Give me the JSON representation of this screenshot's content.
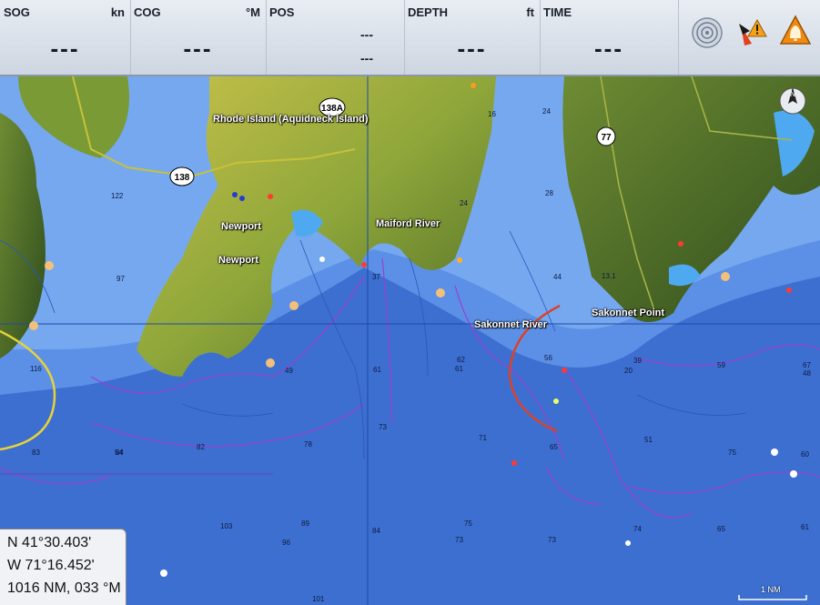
{
  "topbar": {
    "sog": {
      "label": "SOG",
      "unit": "kn",
      "value": "---"
    },
    "cog": {
      "label": "COG",
      "unit": "°M",
      "value": "---"
    },
    "pos": {
      "label": "POS",
      "value_lat": "---",
      "value_lon": "---"
    },
    "depth": {
      "label": "DEPTH",
      "unit": "ft",
      "value": "---"
    },
    "time": {
      "label": "TIME",
      "value": "---"
    },
    "icons": [
      "gps-satellite-icon",
      "alarm-warning-icon",
      "alert-warning-icon"
    ]
  },
  "map": {
    "place_labels": [
      "Rhode Island (Aquidneck Island)",
      "Newport",
      "Newport",
      "Maiford River",
      "Sakonnet River",
      "Sakonnet Point"
    ],
    "route_shields": [
      "138A",
      "138",
      "77"
    ],
    "depth_soundings": [
      "116",
      "122",
      "97",
      "83",
      "84",
      "82",
      "78",
      "73",
      "71",
      "61",
      "37",
      "62",
      "61",
      "56",
      "65",
      "44",
      "59",
      "67",
      "48",
      "39",
      "20",
      "51",
      "75",
      "60",
      "61",
      "74",
      "65",
      "73",
      "89",
      "96",
      "103",
      "101",
      "84",
      "75",
      "73",
      "28",
      "24",
      "16",
      "13.1",
      "24",
      "49",
      "54"
    ],
    "cursor_readout": {
      "lat": "N  41°30.403'",
      "lon": "W  71°16.452'",
      "range_bearing": "1016 NM, 033 °M"
    },
    "scale_label": "1 NM",
    "colors": {
      "deep_water": "#3d6fd0",
      "shallow_water": "#6ea3ee",
      "land": "#8aa23a",
      "contour": "#9a3fd0"
    }
  }
}
